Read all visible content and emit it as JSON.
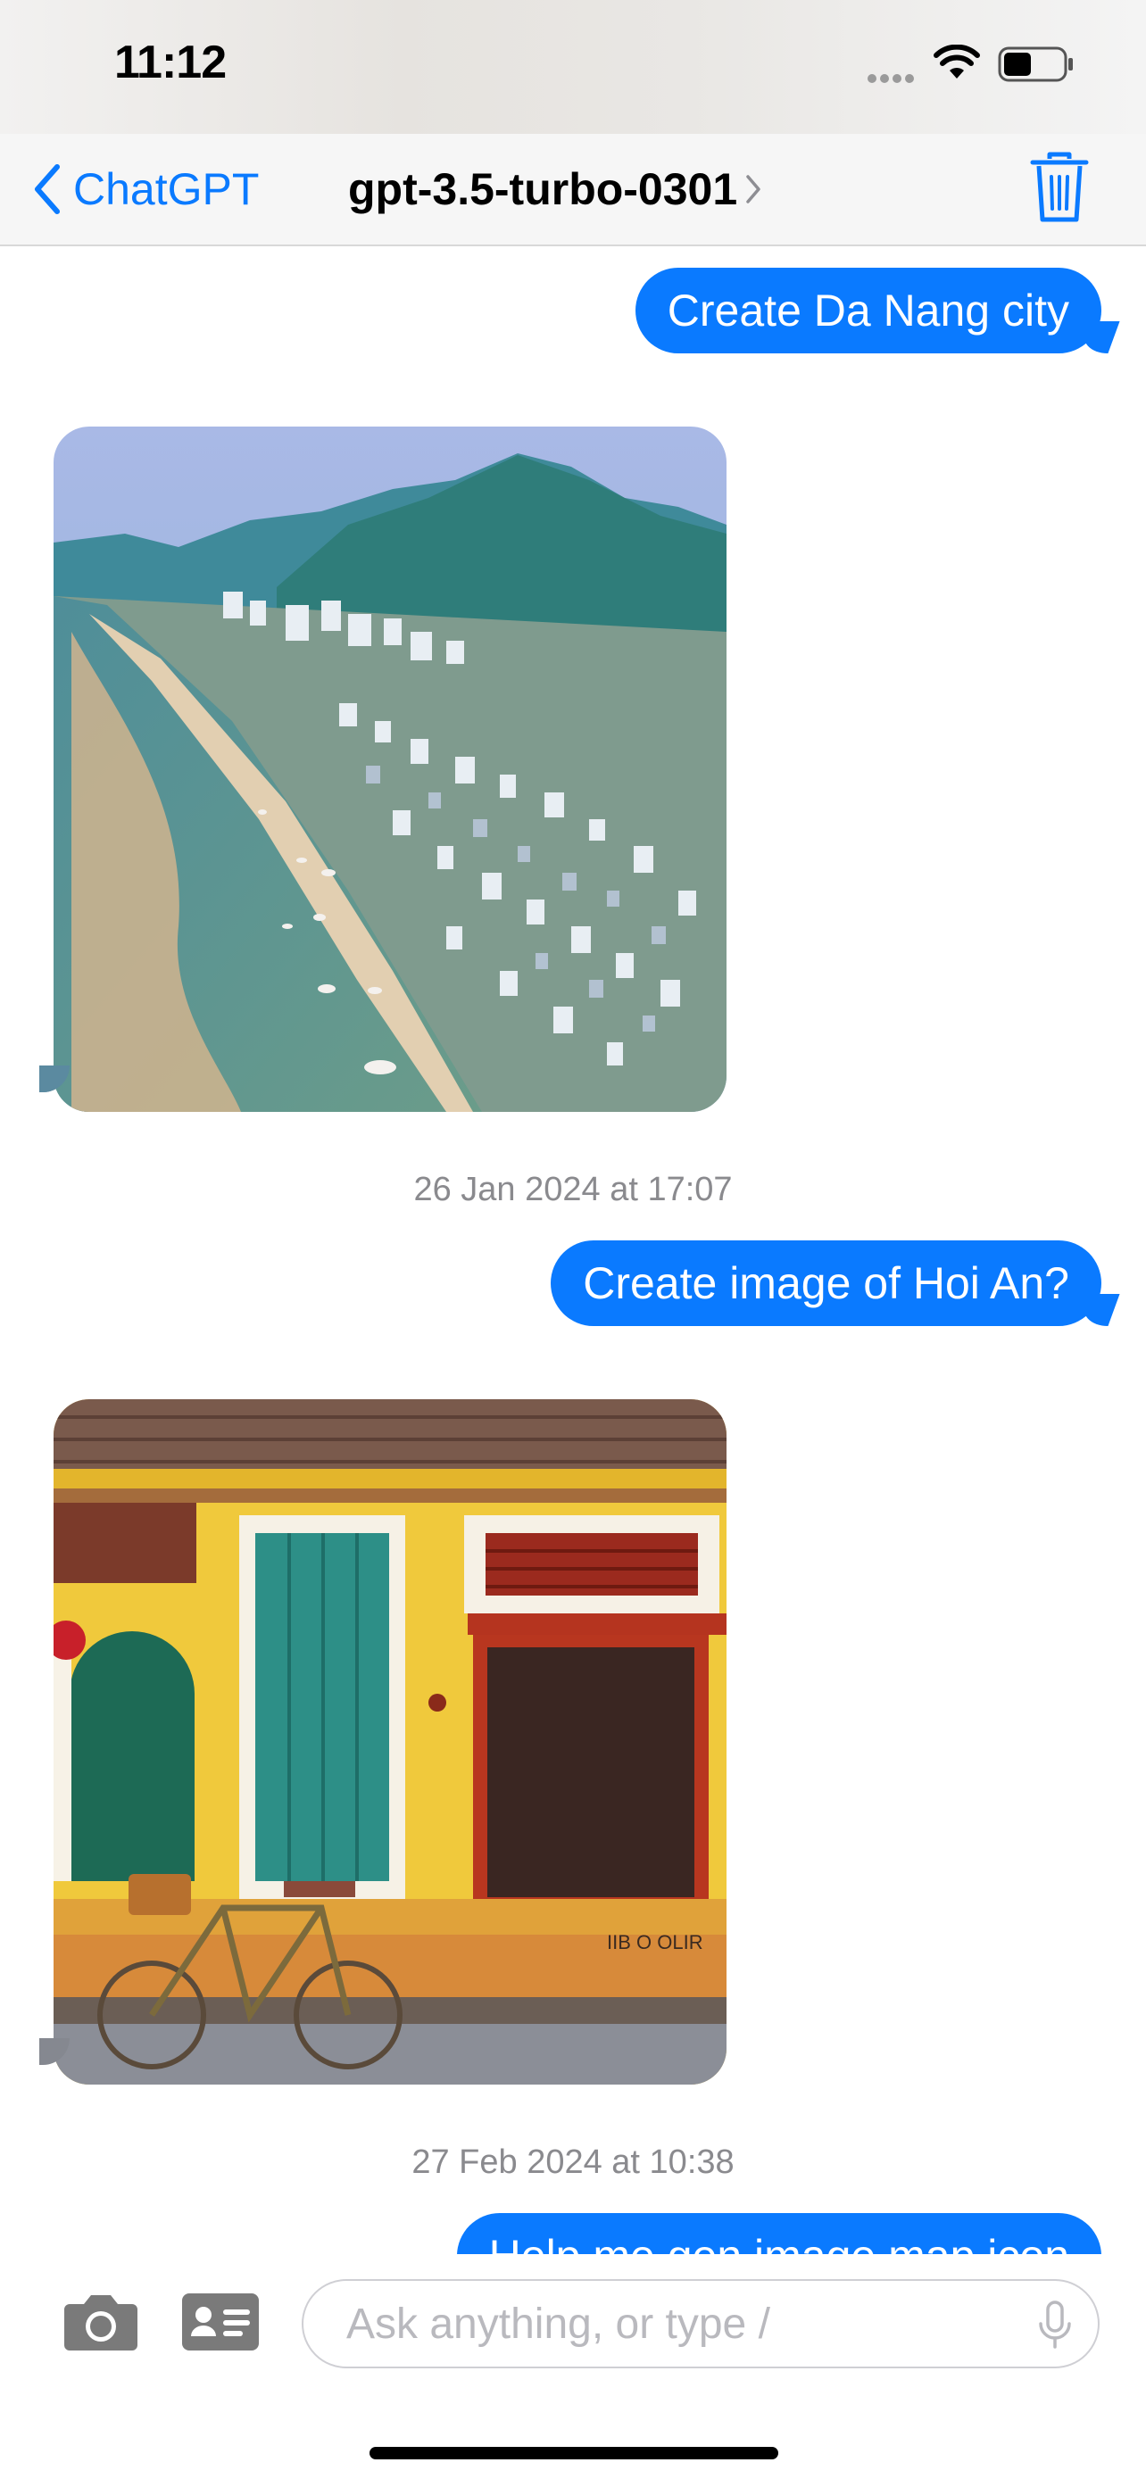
{
  "status_bar": {
    "time": "11:12"
  },
  "nav": {
    "back_label": "ChatGPT",
    "model_title": "gpt-3.5-turbo-0301"
  },
  "messages": [
    {
      "type": "outgoing",
      "text": "Create Da Nang city"
    },
    {
      "type": "image",
      "subject": "Da Nang city"
    },
    {
      "type": "timestamp",
      "text": "26 Jan 2024 at 17:07"
    },
    {
      "type": "outgoing",
      "text": "Create image of Hoi An?"
    },
    {
      "type": "image",
      "subject": "Hoi An"
    },
    {
      "type": "timestamp",
      "text": "27 Feb 2024 at 10:38"
    },
    {
      "type": "outgoing",
      "text": "Help me gen image map icon"
    }
  ],
  "input": {
    "placeholder": "Ask anything, or type /"
  },
  "colors": {
    "accent": "#0a7aff",
    "timestamp": "#8a8a8e",
    "icon_gray": "#7a7a7a"
  },
  "icons": [
    "chevron-left-icon",
    "chevron-right-icon",
    "trash-icon",
    "camera-icon",
    "contact-card-icon",
    "microphone-icon",
    "wifi-icon",
    "battery-icon"
  ]
}
